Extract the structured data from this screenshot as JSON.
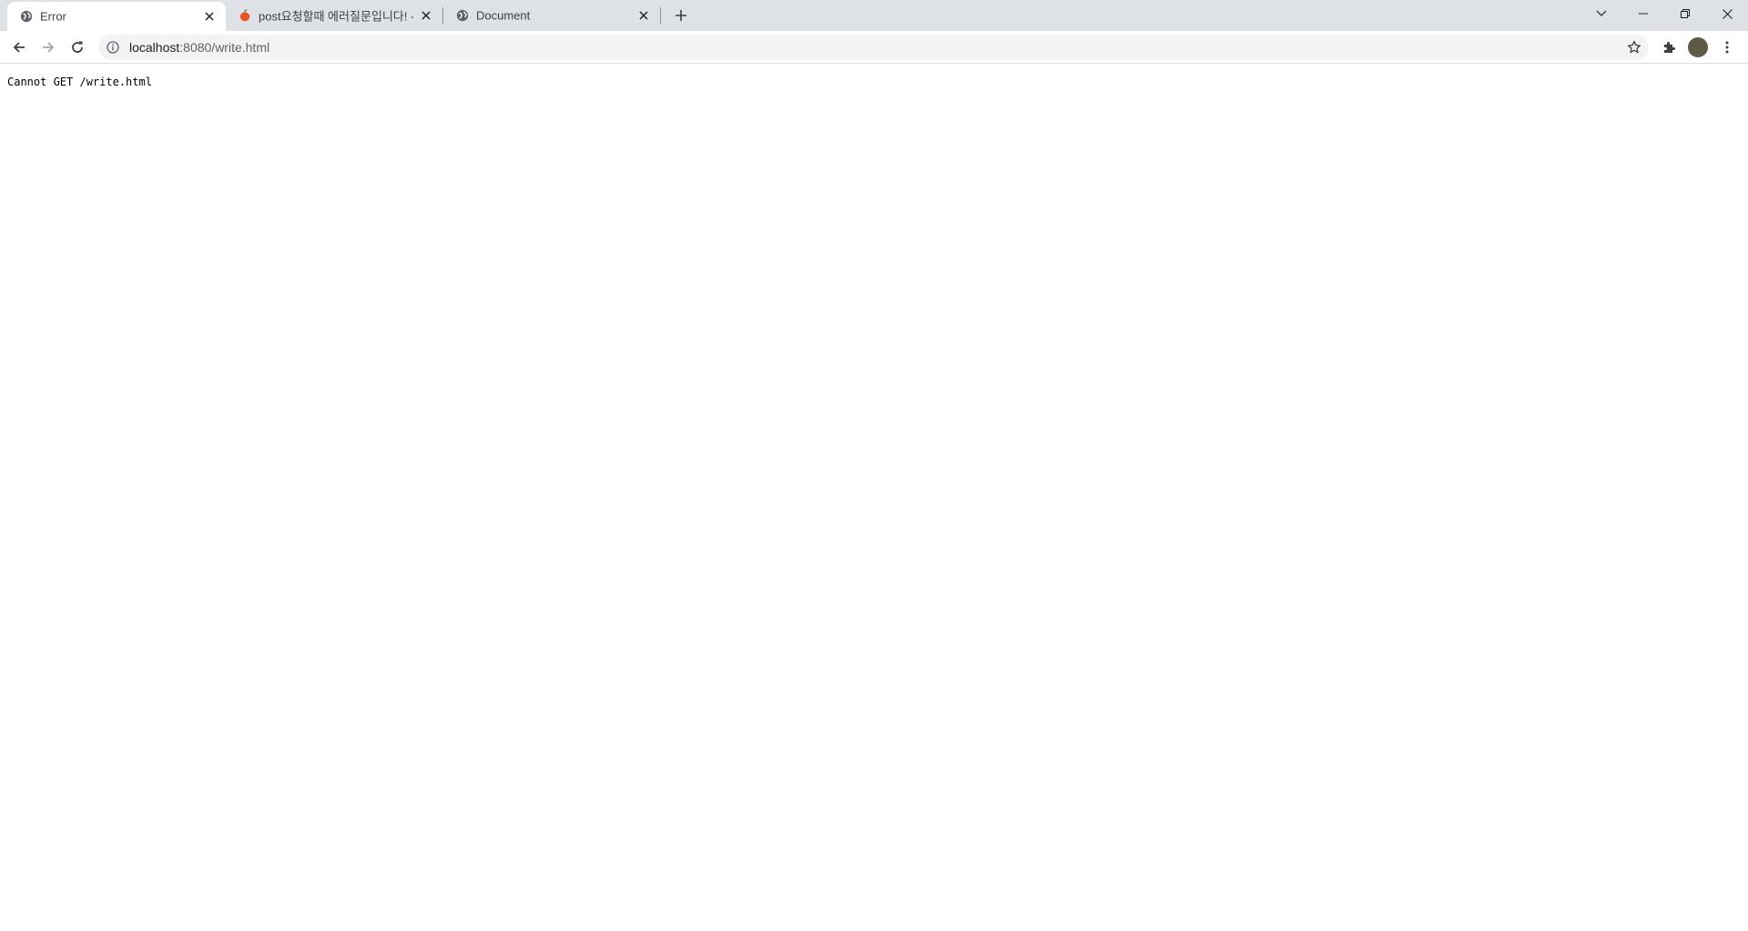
{
  "tabs": [
    {
      "title": "Error",
      "active": true,
      "favicon": "globe-icon"
    },
    {
      "title": "post요청할때 에러질문입니다! - ",
      "active": false,
      "favicon": "apple-icon"
    },
    {
      "title": "Document",
      "active": false,
      "favicon": "globe-icon"
    }
  ],
  "address_bar": {
    "host": "localhost",
    "path": ":8080/write.html"
  },
  "page": {
    "body_text": "Cannot GET /write.html"
  },
  "colors": {
    "tabstrip_bg": "#dee1e6",
    "omnibox_bg": "#f1f3f4",
    "avatar": "#5e5a45"
  }
}
